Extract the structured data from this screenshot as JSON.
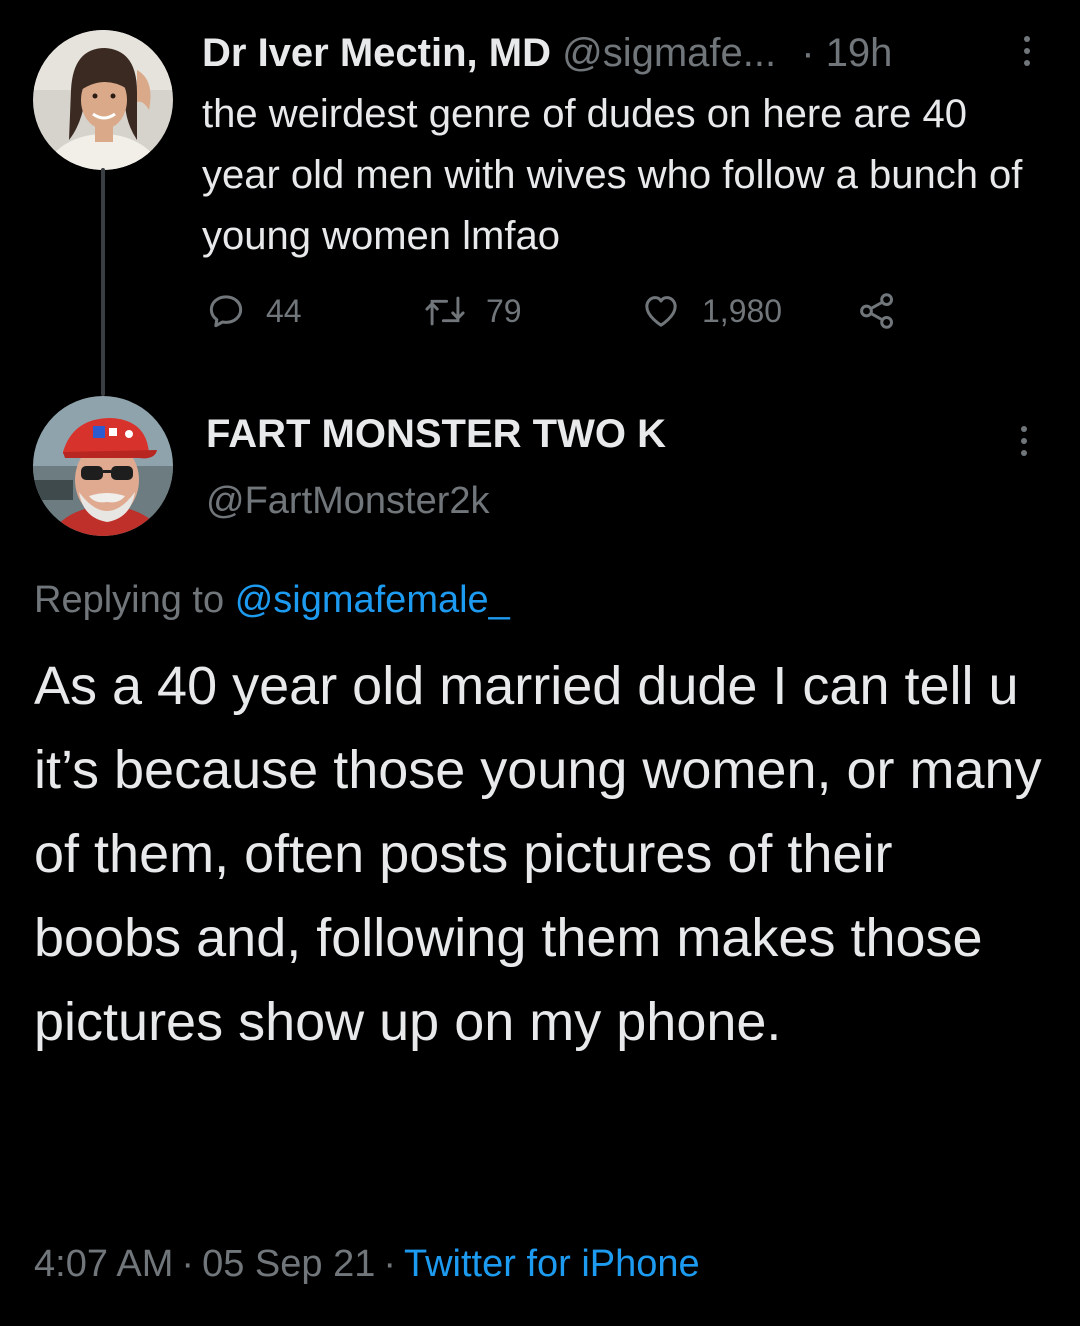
{
  "original_tweet": {
    "display_name": "Dr Iver Mectin, MD",
    "handle": "@sigmafe...",
    "separator": "·",
    "time": "19h",
    "text": "the weirdest genre of dudes on here are 40 year old men with wives who follow a bunch of young women lmfao",
    "stats": {
      "replies": "44",
      "retweets": "79",
      "likes": "1,980"
    },
    "icons": {
      "reply": "speech-bubble-icon",
      "retweet": "retweet-arrows-icon",
      "like": "heart-icon",
      "share": "share-nodes-icon",
      "more": "vertical-dots-icon"
    }
  },
  "reply_tweet": {
    "display_name": "FART MONSTER TWO K",
    "handle": "@FartMonster2k",
    "replying_prefix": "Replying to",
    "replying_to": "@sigmafemale_",
    "text": "As a 40 year old married dude I can tell u it’s because those young women, or many of them, often posts pictures of their boobs and, following them makes those pictures show up on my phone.",
    "time": "4:07 AM",
    "date": "05 Sep 21",
    "source": "Twitter for iPhone",
    "separator": "·"
  },
  "colors": {
    "background": "#000000",
    "primary_text": "#e7e9ea",
    "secondary_text": "#71767b",
    "link": "#1d9bf0",
    "thread_line": "#3a3d41"
  }
}
